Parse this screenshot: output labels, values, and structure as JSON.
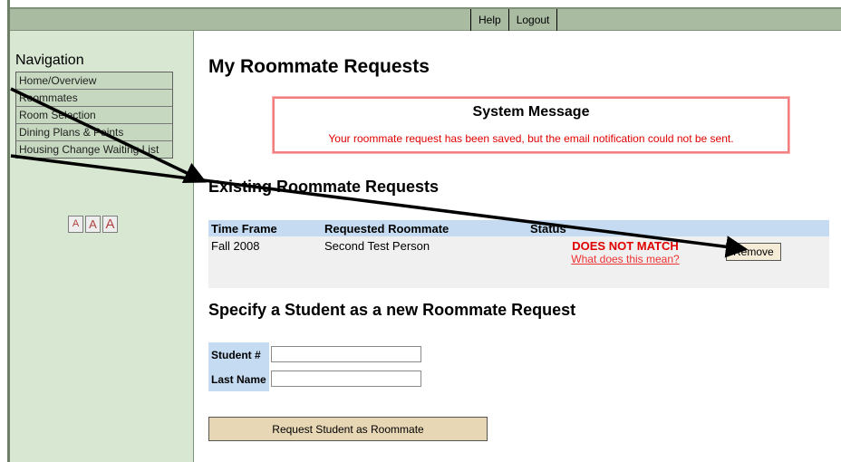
{
  "topbar": {
    "help": "Help",
    "logout": "Logout"
  },
  "navigation": {
    "title": "Navigation",
    "items": [
      {
        "label": "Home/Overview"
      },
      {
        "label": "Roommates"
      },
      {
        "label": "Room Selection"
      },
      {
        "label": "Dining Plans & Points"
      },
      {
        "label": "Housing Change Waiting List"
      }
    ],
    "text_size_buttons": [
      "A",
      "A",
      "A"
    ]
  },
  "main": {
    "title": "My Roommate Requests",
    "system_message": {
      "title": "System Message",
      "text": "Your roommate request has been saved, but the email notification could not be sent."
    },
    "existing_heading": "Existing Roommate Requests",
    "table": {
      "headers": [
        "Time Frame",
        "Requested Roommate",
        "Status",
        ""
      ],
      "rows": [
        {
          "time_frame": "Fall 2008",
          "roommate": "Second Test Person",
          "status": "DOES NOT MATCH",
          "status_help": "What does this mean?",
          "action": "Remove"
        }
      ]
    },
    "new_heading": "Specify a Student as a new Roommate Request",
    "form": {
      "student_label": "Student #",
      "student_value": "",
      "last_name_label": "Last Name",
      "last_name_value": "",
      "submit_label": "Request Student as Roommate"
    }
  },
  "colors": {
    "accent": "#e00000",
    "header_bg": "#c4dbf2",
    "nav_bg": "#d7e7d1",
    "topbar_bg": "#a9bba1"
  }
}
